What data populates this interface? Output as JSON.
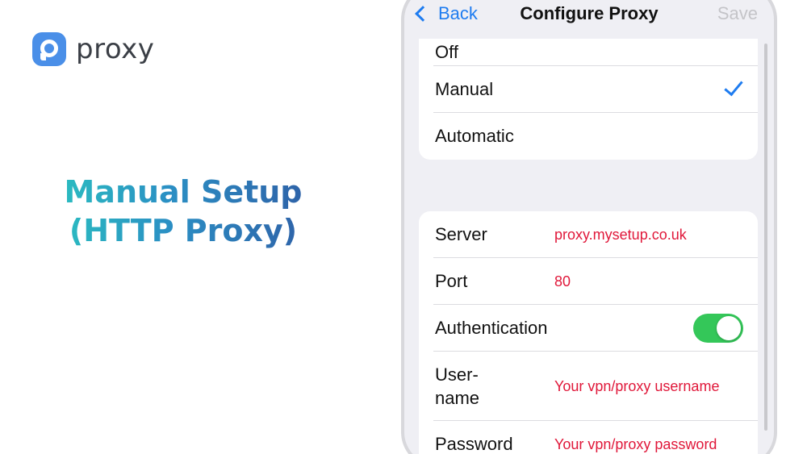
{
  "brand": {
    "name": "proxy",
    "icon": "proxy-logo-icon",
    "color": "#4a8fe8"
  },
  "headline": {
    "line1": "Manual Setup",
    "line2": "(HTTP Proxy)"
  },
  "nav": {
    "back_label": "Back",
    "title": "Configure Proxy",
    "save_label": "Save"
  },
  "mode_options": [
    {
      "label": "Off",
      "selected": false
    },
    {
      "label": "Manual",
      "selected": true
    },
    {
      "label": "Automatic",
      "selected": false
    }
  ],
  "fields": {
    "server": {
      "label": "Server",
      "value": "proxy.mysetup.co.uk"
    },
    "port": {
      "label": "Port",
      "value": "80"
    },
    "authentication": {
      "label": "Authentication",
      "enabled": true
    },
    "username": {
      "label_line1": "User-",
      "label_line2": "name",
      "value": "Your vpn/proxy username"
    },
    "password": {
      "label": "Password",
      "value": "Your vpn/proxy password"
    }
  },
  "colors": {
    "accent": "#1e7cf0",
    "toggle_on": "#34c759",
    "annotation": "#e0183a"
  }
}
